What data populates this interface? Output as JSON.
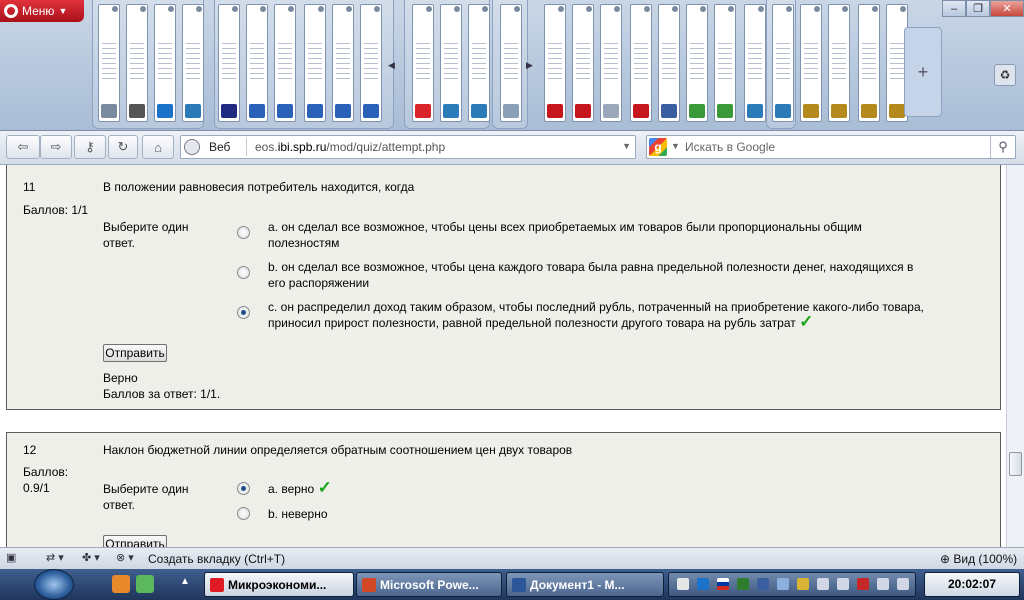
{
  "browser": {
    "menu_label": "Меню",
    "tab_thumbnails": [
      "wand",
      "settings",
      "cup",
      "doc",
      "F",
      "mail",
      "mail",
      "mail",
      "mail",
      "mail",
      "RB",
      "doc",
      "doc",
      "pen",
      "ME",
      "R",
      "gray",
      "flag",
      "flask",
      "chat",
      "chat",
      "doc",
      "doc",
      "stamp",
      "stamp",
      "stamp",
      "stamp"
    ],
    "new_tab_symbol": "+",
    "trash_symbol": "♻",
    "window_controls": {
      "minimize": "–",
      "maximize": "❐",
      "close": "✕"
    }
  },
  "toolbar": {
    "back_symbol": "⇦",
    "forward_symbol": "⇨",
    "key_symbol": "⚷",
    "reload_symbol": "↻",
    "home_symbol": "⌂",
    "web_label": "Веб",
    "url_host_prefix": "eos.",
    "url_host_main": "ibi.spb.ru",
    "url_path": "/mod/quiz/attempt.php",
    "search_engine_letter": "g",
    "search_placeholder": "Искать в Google",
    "search_button_symbol": "⚲"
  },
  "questions": [
    {
      "number": "11",
      "grade": "Баллов: 1/1",
      "text": "В положении равновесия потребитель находится, когда",
      "prompt": "Выберите один ответ.",
      "options": [
        {
          "text": "a. он сделал все возможное, чтобы цены всех приобретаемых им товаров были пропорциональны общим полезностям",
          "selected": false,
          "correct_mark": ""
        },
        {
          "text": "b. он сделал все возможное, чтобы цена каждого товара была равна предельной полезности денег, находящихся в его распоряжении",
          "selected": false,
          "correct_mark": ""
        },
        {
          "text": "c. он распределил доход таким образом, чтобы последний рубль, потраченный на приобретение какого-либо товара, приносил прирост полезности, равной предельной полезности другого товара на рубль затрат",
          "selected": true,
          "correct_mark": "✓"
        }
      ],
      "submit_label": "Отправить",
      "feedback_status": "Верно",
      "feedback_points": "Баллов за ответ: 1/1."
    },
    {
      "number": "12",
      "grade": "Баллов: 0.9/1",
      "text": "Наклон бюджетной линии определяется обратным соотношением цен двух товаров",
      "prompt": "Выберите один ответ.",
      "options": [
        {
          "text": "a. верно",
          "selected": true,
          "correct_mark": "✓"
        },
        {
          "text": "b. неверно",
          "selected": false,
          "correct_mark": ""
        }
      ],
      "submit_label": "Отправить"
    }
  ],
  "statusbar": {
    "new_tab_label": "Создать вкладку (Ctrl+T)",
    "zoom_label": "Вид (100%)"
  },
  "taskbar": {
    "tasks": [
      {
        "label": "Микроэкономи...",
        "active": true,
        "icon_color": "#e01b24"
      },
      {
        "label": "Microsoft Powe...",
        "active": false,
        "icon_color": "#d24726"
      },
      {
        "label": "Документ1 - М...",
        "active": false,
        "icon_color": "#2b579a"
      }
    ],
    "clock": "20:02:07"
  }
}
